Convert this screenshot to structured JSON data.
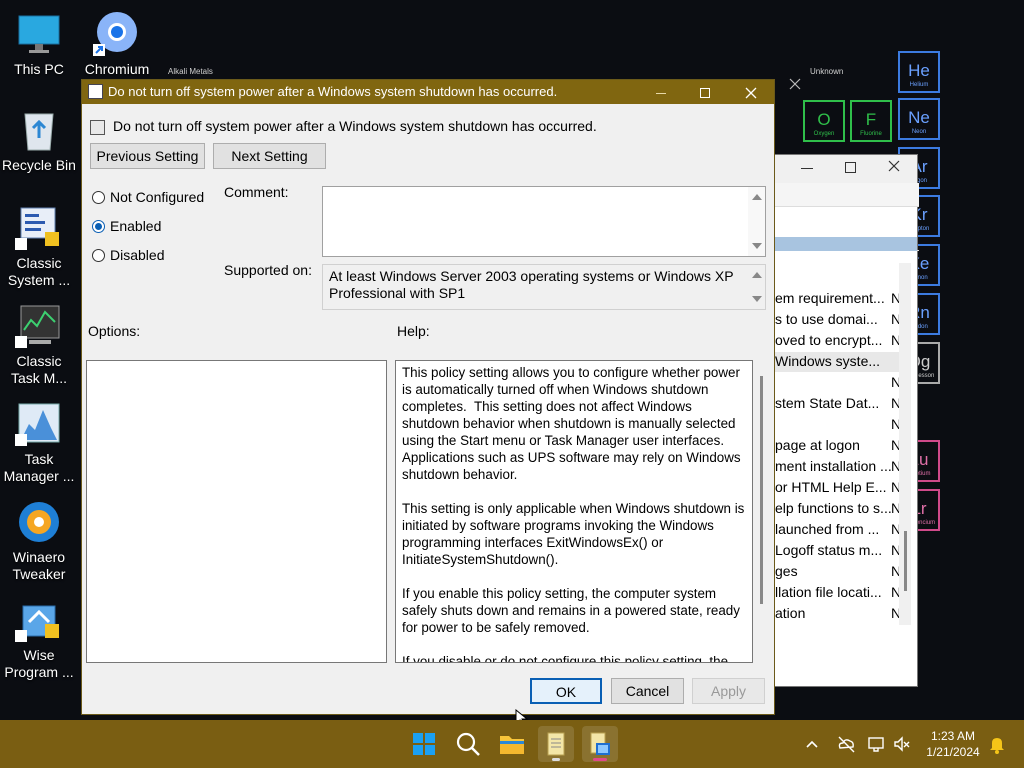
{
  "desktop": {
    "icons": [
      {
        "label": "This PC",
        "icon": "monitor-icon"
      },
      {
        "label": "Chromium",
        "icon": "chromium-icon"
      },
      {
        "label": "Recycle Bin",
        "icon": "recycle-bin-icon"
      },
      {
        "label": "Classic System ...",
        "icon": "classic-system-icon"
      },
      {
        "label": "Classic Task M...",
        "icon": "classic-task-manager-icon"
      },
      {
        "label": "Task Manager ...",
        "icon": "task-manager-icon"
      },
      {
        "label": "Winaero Tweaker",
        "icon": "winaero-tweaker-icon"
      },
      {
        "label": "Wise Program ...",
        "icon": "wise-program-icon"
      }
    ]
  },
  "wallpaper": {
    "header_left": "Alkali Metals",
    "header_right": "Unknown",
    "elements": [
      {
        "symbol": "O",
        "name": "Oxygen"
      },
      {
        "symbol": "F",
        "name": "Fluorine"
      },
      {
        "symbol": "He",
        "name": "Helium"
      },
      {
        "symbol": "Ne",
        "name": "Neon"
      },
      {
        "symbol": "Ar",
        "name": "Argon"
      },
      {
        "symbol": "Kr",
        "name": "Krypton"
      },
      {
        "symbol": "Xe",
        "name": "Xenon"
      },
      {
        "symbol": "Rn",
        "name": "Radon"
      },
      {
        "symbol": "Og",
        "name": "Oganesson"
      },
      {
        "symbol": "Lu",
        "name": "Lutetium"
      },
      {
        "symbol": "Lr",
        "name": "Lawrencium"
      }
    ]
  },
  "background_window": {
    "rows": [
      {
        "text": "em requirement...",
        "state": "N"
      },
      {
        "text": "s to use domai...",
        "state": "N"
      },
      {
        "text": "oved to encrypt...",
        "state": "N"
      },
      {
        "text": "Windows syste...",
        "state": ""
      },
      {
        "text": "",
        "state": "N"
      },
      {
        "text": "stem State Dat...",
        "state": "N"
      },
      {
        "text": "",
        "state": "N"
      },
      {
        "text": "page at logon",
        "state": "N"
      },
      {
        "text": "ment installation ...",
        "state": "N"
      },
      {
        "text": "or HTML Help E...",
        "state": "N"
      },
      {
        "text": "elp functions to s...",
        "state": "N"
      },
      {
        "text": "launched from ...",
        "state": "N"
      },
      {
        "text": "Logoff status m...",
        "state": "N"
      },
      {
        "text": "ges",
        "state": "N"
      },
      {
        "text": "llation file locati...",
        "state": "N"
      },
      {
        "text": "ation",
        "state": "N"
      }
    ]
  },
  "dialog": {
    "title": "Do not turn off system power after a Windows system shutdown has occurred.",
    "setting_name": "Do not turn off system power after a Windows system shutdown has occurred.",
    "previous_label": "Previous Setting",
    "next_label": "Next Setting",
    "radio_not_configured": "Not Configured",
    "radio_enabled": "Enabled",
    "radio_disabled": "Disabled",
    "selected": "Enabled",
    "comment_label": "Comment:",
    "comment_value": "",
    "supported_label": "Supported on:",
    "supported_value": "At least Windows Server 2003 operating systems or Windows XP Professional with SP1",
    "options_label": "Options:",
    "help_label": "Help:",
    "help_text": "This policy setting allows you to configure whether power is automatically turned off when Windows shutdown completes.  This setting does not affect Windows shutdown behavior when shutdown is manually selected using the Start menu or Task Manager user interfaces.  Applications such as UPS software may rely on Windows shutdown behavior.\n\nThis setting is only applicable when Windows shutdown is initiated by software programs invoking the Windows programming interfaces ExitWindowsEx() or InitiateSystemShutdown().\n\nIf you enable this policy setting, the computer system safely shuts down and remains in a powered state, ready for power to be safely removed.\n\nIf you disable or do not configure this policy setting, the",
    "ok_label": "OK",
    "cancel_label": "Cancel",
    "apply_label": "Apply"
  },
  "taskbar": {
    "icons": [
      "windows-start-icon",
      "search-icon",
      "file-explorer-icon",
      "notepad-icon",
      "group-policy-icon"
    ],
    "time": "1:23 AM",
    "date": "1/21/2024"
  }
}
